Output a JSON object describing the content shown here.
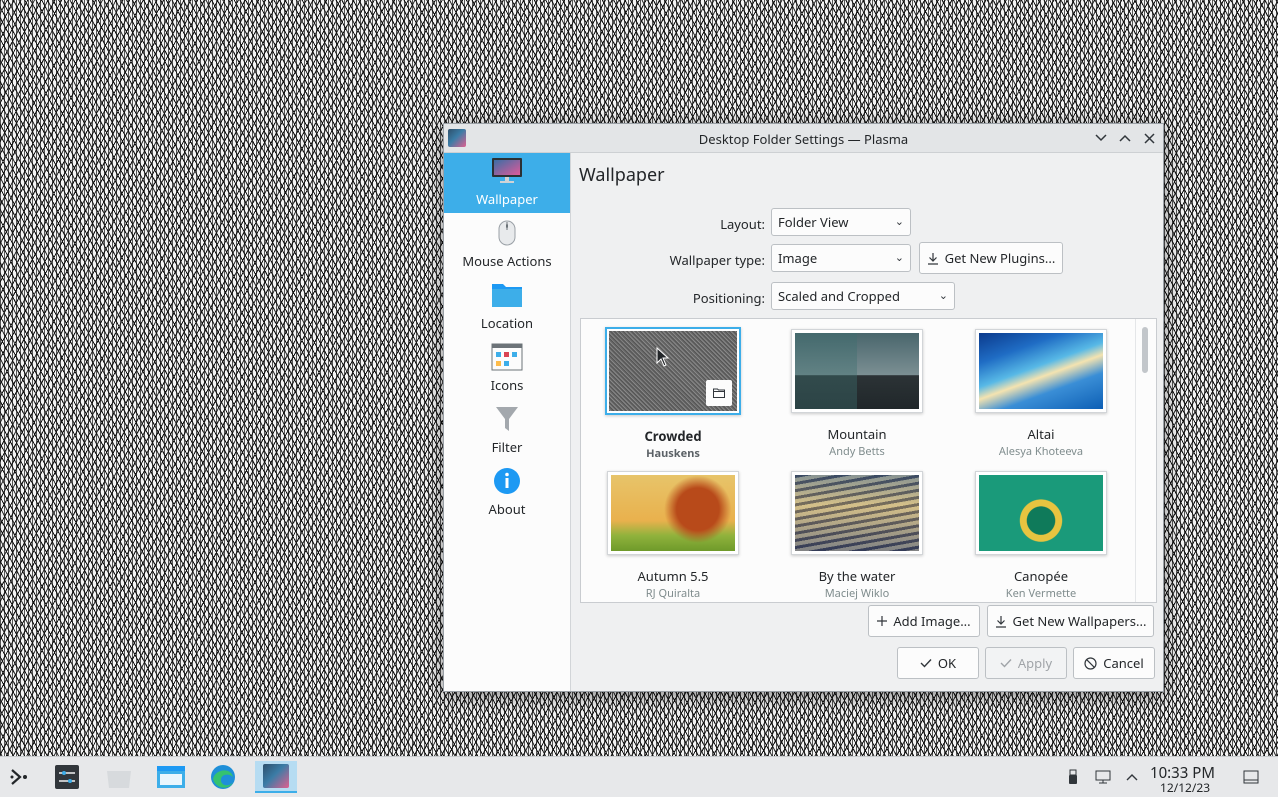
{
  "window": {
    "title": "Desktop Folder Settings — Plasma",
    "controls": {
      "minimize": "⌄",
      "maximize": "⌃",
      "close": "✕"
    }
  },
  "sidebar": {
    "items": [
      {
        "label": "Wallpaper",
        "icon": "monitor-icon",
        "active": true
      },
      {
        "label": "Mouse Actions",
        "icon": "mouse-icon"
      },
      {
        "label": "Location",
        "icon": "folder-icon"
      },
      {
        "label": "Icons",
        "icon": "icons-grid-icon"
      },
      {
        "label": "Filter",
        "icon": "filter-icon"
      },
      {
        "label": "About",
        "icon": "info-icon"
      }
    ]
  },
  "page": {
    "title": "Wallpaper",
    "layout": {
      "label": "Layout:",
      "value": "Folder View"
    },
    "wallpaper_type": {
      "label": "Wallpaper type:",
      "value": "Image"
    },
    "get_new_plugins": "Get New Plugins...",
    "positioning": {
      "label": "Positioning:",
      "value": "Scaled and Cropped"
    }
  },
  "wallpapers": [
    {
      "name": "Crowded",
      "author": "Hauskens",
      "selected": true
    },
    {
      "name": "Mountain",
      "author": "Andy Betts"
    },
    {
      "name": "Altai",
      "author": "Alesya Khoteeva"
    },
    {
      "name": "Autumn 5.5",
      "author": "RJ Quiralta"
    },
    {
      "name": "By the water",
      "author": "Maciej Wiklo"
    },
    {
      "name": "Canopée",
      "author": "Ken Vermette"
    }
  ],
  "buttons": {
    "add_image": "Add Image...",
    "get_new_wallpapers": "Get New Wallpapers...",
    "ok": "OK",
    "apply": "Apply",
    "cancel": "Cancel"
  },
  "taskbar": {
    "time": "10:33 PM",
    "date": "12/12/23"
  },
  "colors": {
    "accent": "#3daee9",
    "window_bg": "#eff0f1"
  }
}
